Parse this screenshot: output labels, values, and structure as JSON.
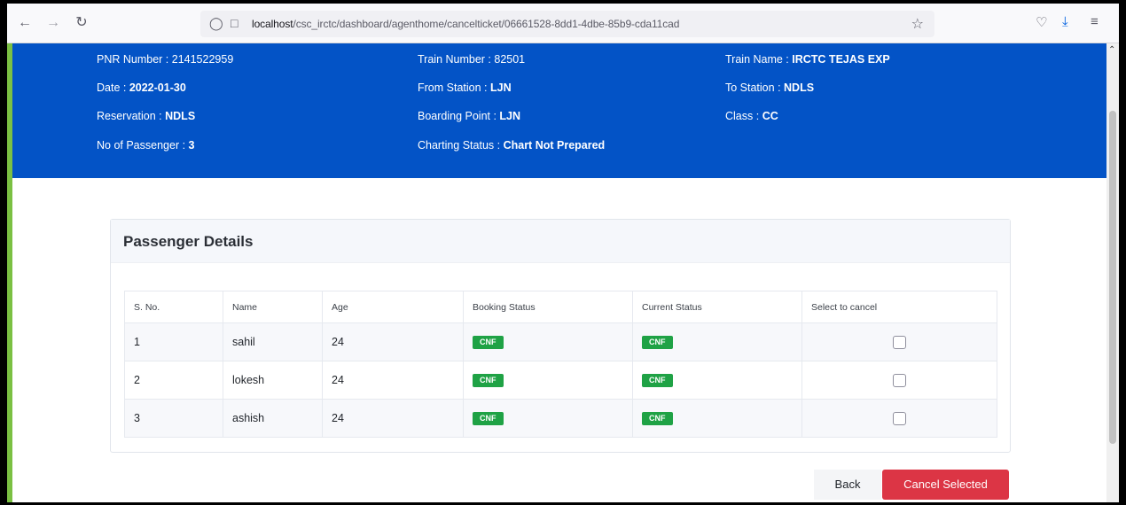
{
  "browser": {
    "url_host": "localhost",
    "url_path": "/csc_irctc/dashboard/agenthome/cancelticket/06661528-8dd1-4dbe-85b9-cda11cad",
    "icons": {
      "back": "arrow-left-icon",
      "forward": "arrow-right-icon",
      "reload": "reload-icon",
      "shield": "shield-icon",
      "page": "page-icon",
      "bookmark": "star-icon",
      "pocket": "pocket-icon",
      "downloads": "download-icon",
      "menu": "hamburger-menu-icon"
    }
  },
  "ticket": {
    "pnr": {
      "label": "PNR Number : ",
      "value": "2141522959"
    },
    "train_number": {
      "label": "Train Number : ",
      "value": "82501"
    },
    "train_name": {
      "label": "Train Name : ",
      "value": "IRCTC TEJAS EXP"
    },
    "date": {
      "label": "Date : ",
      "value": "2022-01-30"
    },
    "from_station": {
      "label": "From Station : ",
      "value": "LJN"
    },
    "to_station": {
      "label": "To Station : ",
      "value": "NDLS"
    },
    "reservation": {
      "label": "Reservation : ",
      "value": "NDLS"
    },
    "boarding_point": {
      "label": "Boarding Point : ",
      "value": "LJN"
    },
    "class": {
      "label": "Class : ",
      "value": "CC"
    },
    "passengers": {
      "label": "No of Passenger : ",
      "value": "3"
    },
    "charting_status": {
      "label": "Charting Status : ",
      "value": "Chart Not Prepared"
    }
  },
  "passenger_card": {
    "title": "Passenger Details",
    "columns": [
      "S. No.",
      "Name",
      "Age",
      "Booking Status",
      "Current Status",
      "Select to cancel"
    ],
    "rows": [
      {
        "sno": "1",
        "name": "sahil",
        "age": "24",
        "booking": "CNF",
        "current": "CNF"
      },
      {
        "sno": "2",
        "name": "lokesh",
        "age": "24",
        "booking": "CNF",
        "current": "CNF"
      },
      {
        "sno": "3",
        "name": "ashish",
        "age": "24",
        "booking": "CNF",
        "current": "CNF"
      }
    ]
  },
  "actions": {
    "back": "Back",
    "cancel_selected": "Cancel Selected"
  },
  "colors": {
    "banner": "#0353c6",
    "badge": "#1fa245",
    "cancel_button": "#dc3545",
    "left_accent": "#7bc043"
  }
}
